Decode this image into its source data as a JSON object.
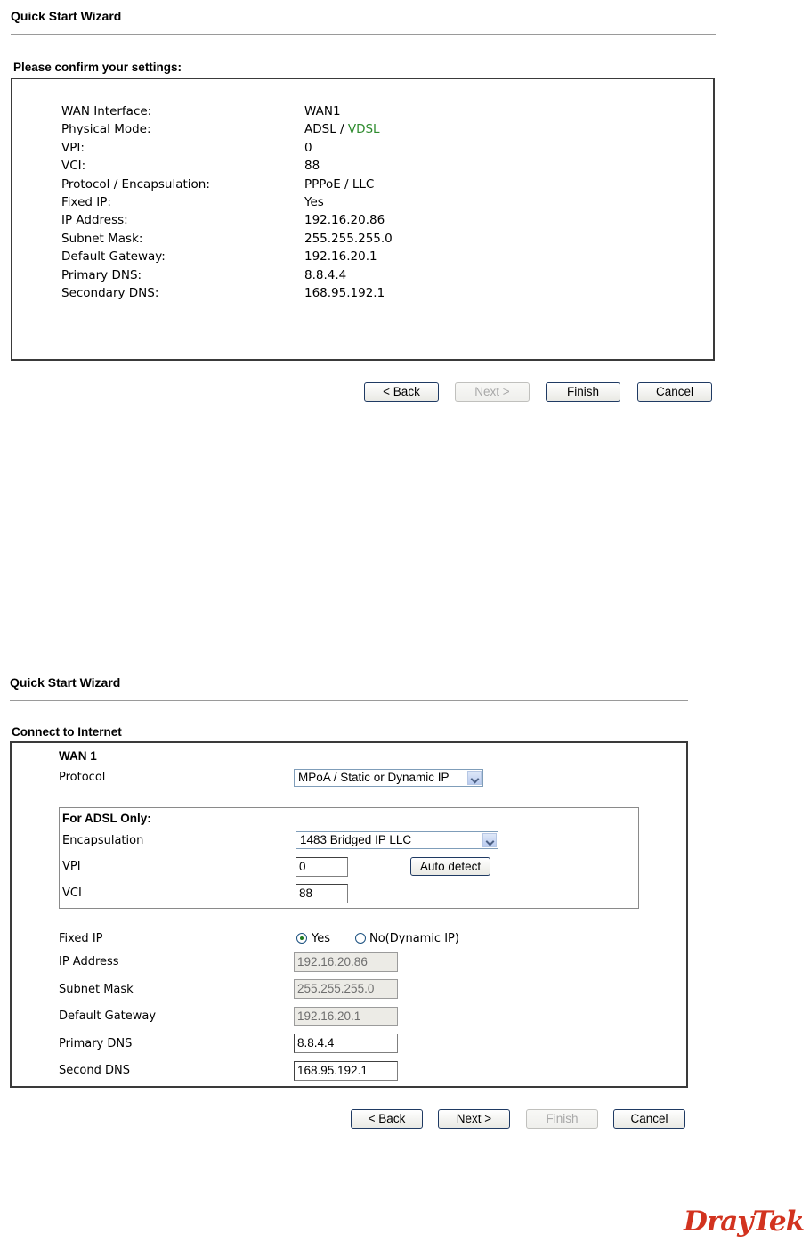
{
  "screen1": {
    "title": "Quick Start Wizard",
    "heading": "Please confirm your settings:",
    "rows": [
      {
        "label": "WAN Interface:",
        "value": "WAN1"
      },
      {
        "label": "Physical Mode:",
        "value": "ADSL / ",
        "value_highlight": "VDSL"
      },
      {
        "label": "VPI:",
        "value": "0"
      },
      {
        "label": "VCI:",
        "value": "88"
      },
      {
        "label": "Protocol / Encapsulation:",
        "value": "PPPoE / LLC"
      },
      {
        "label": "Fixed IP:",
        "value": "Yes"
      },
      {
        "label": "IP Address:",
        "value": "192.16.20.86"
      },
      {
        "label": "Subnet Mask:",
        "value": "255.255.255.0"
      },
      {
        "label": "Default Gateway:",
        "value": "192.16.20.1"
      },
      {
        "label": "Primary DNS:",
        "value": "8.8.4.4"
      },
      {
        "label": "Secondary DNS:",
        "value": "168.95.192.1"
      }
    ],
    "buttons": {
      "back": "< Back",
      "next": "Next >",
      "finish": "Finish",
      "cancel": "Cancel"
    }
  },
  "screen2": {
    "title": "Quick Start Wizard",
    "heading": "Connect to Internet",
    "wan_title": "WAN 1",
    "protocol_label": "Protocol",
    "protocol_value": "MPoA / Static or Dynamic IP",
    "adsl_group_title": "For ADSL Only:",
    "encapsulation_label": "Encapsulation",
    "encapsulation_value": "1483 Bridged IP LLC",
    "vpi_label": "VPI",
    "vpi_value": "0",
    "auto_detect": "Auto detect",
    "vci_label": "VCI",
    "vci_value": "88",
    "fixed_ip_label": "Fixed IP",
    "fixed_ip_yes": "Yes",
    "fixed_ip_no": "No(Dynamic IP)",
    "fixed_ip_selected": "Yes",
    "ip_label": "IP Address",
    "ip_value": "192.16.20.86",
    "mask_label": "Subnet Mask",
    "mask_value": "255.255.255.0",
    "gateway_label": "Default Gateway",
    "gateway_value": "192.16.20.1",
    "pdns_label": "Primary DNS",
    "pdns_value": "8.8.4.4",
    "sdns_label": "Second DNS",
    "sdns_value": "168.95.192.1",
    "buttons": {
      "back": "< Back",
      "next": "Next >",
      "finish": "Finish",
      "cancel": "Cancel"
    }
  },
  "brand": {
    "logo_part1": "Dray",
    "logo_part2": "Tek",
    "color": "#d2331f"
  }
}
